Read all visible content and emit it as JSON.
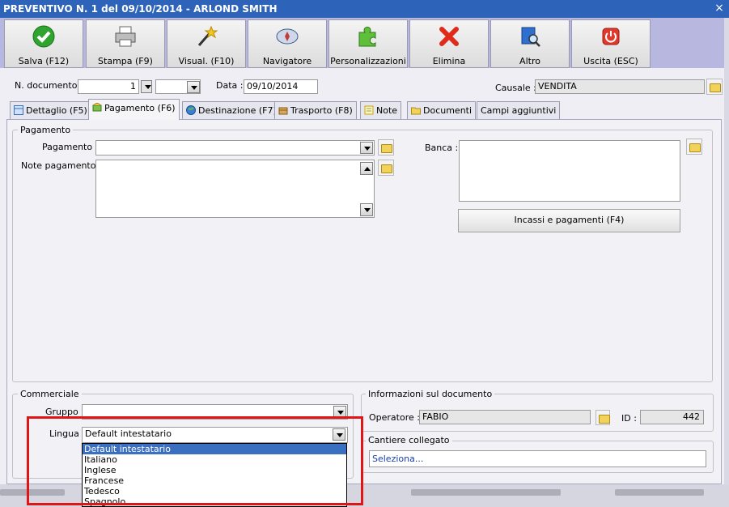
{
  "window": {
    "title": "PREVENTIVO N. 1 del 09/10/2014 - ARLOND SMITH",
    "close": "×"
  },
  "toolbar": {
    "buttons": [
      {
        "label": "Salva (F12)",
        "icon": "check-icon"
      },
      {
        "label": "Stampa (F9)",
        "icon": "printer-icon"
      },
      {
        "label": "Visual. (F10)",
        "icon": "magic-wand-icon"
      },
      {
        "label": "Navigatore",
        "icon": "compass-icon"
      },
      {
        "label": "Personalizzazioni",
        "icon": "puzzle-icon"
      },
      {
        "label": "Elimina",
        "icon": "delete-x-icon"
      },
      {
        "label": "Altro",
        "icon": "book-search-icon"
      },
      {
        "label": "Uscita (ESC)",
        "icon": "power-icon"
      }
    ]
  },
  "header": {
    "n_documento_label": "N. documento :",
    "n_documento_value": "1",
    "data_label": "Data :",
    "data_value": "09/10/2014",
    "causale_label": "Causale :",
    "causale_value": "VENDITA"
  },
  "tabs": [
    {
      "label": "Dettaglio (F5)",
      "icon": "grid-icon"
    },
    {
      "label": "Pagamento (F6)",
      "icon": "payment-icon"
    },
    {
      "label": "Destinazione (F7)",
      "icon": "globe-icon"
    },
    {
      "label": "Trasporto (F8)",
      "icon": "box-icon"
    },
    {
      "label": "Note",
      "icon": "note-icon"
    },
    {
      "label": "Documenti",
      "icon": "folder-icon"
    },
    {
      "label": "Campi aggiuntivi",
      "icon": ""
    }
  ],
  "pagamento": {
    "group_title": "Pagamento",
    "pagamento_label": "Pagamento :",
    "pagamento_value": "",
    "note_label": "Note pagamento :",
    "note_value": "",
    "banca_label": "Banca :",
    "banca_value": "",
    "incassi_button": "Incassi e pagamenti (F4)"
  },
  "commerciale": {
    "group_title": "Commerciale",
    "gruppo_label": "Gruppo :",
    "gruppo_value": "",
    "lingua_label": "Lingua :",
    "lingua_value": "Default intestatario",
    "lingua_options": [
      "Default intestatario",
      "Italiano",
      "Inglese",
      "Francese",
      "Tedesco",
      "Spagnolo"
    ]
  },
  "info_documento": {
    "group_title": "Informazioni sul documento",
    "operatore_label": "Operatore :",
    "operatore_value": "FABIO",
    "id_label": "ID :",
    "id_value": "442"
  },
  "cantiere": {
    "group_title": "Cantiere collegato",
    "value": "Seleziona..."
  }
}
